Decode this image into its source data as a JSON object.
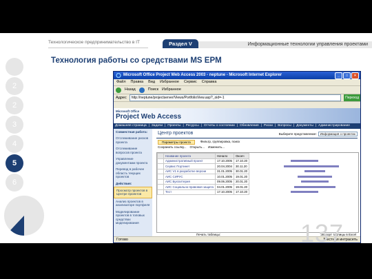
{
  "header": {
    "course_title": "Технологическое предпринимательство в IT",
    "section_label": "Раздел V",
    "section_title": "Информационные технологии управления проектами"
  },
  "slide_numbers": [
    {
      "label": "",
      "active": false
    },
    {
      "label": "2",
      "active": false
    },
    {
      "label": "2",
      "active": false
    },
    {
      "label": "3",
      "active": false
    },
    {
      "label": "4",
      "active": false
    },
    {
      "label": "5",
      "active": true
    },
    {
      "label": "6",
      "active": false
    }
  ],
  "progress": {
    "fraction": 0.12,
    "accent": "#1d3f73"
  },
  "slide": {
    "title": "Технология работы со средствами MS EPM",
    "page_number": "137"
  },
  "browser": {
    "window_title": "Microsoft Office Project Web Access 2003 - neptune - Microsoft Internet Explorer",
    "menu": [
      "Файл",
      "Правка",
      "Вид",
      "Избранное",
      "Сервис",
      "Справка"
    ],
    "toolbar": [
      "Назад",
      "Поиск",
      "Избранное"
    ],
    "address_label": "Адрес",
    "address_value": "http://neptune/projectserver/Views/PortfolioView.asp?_oid=-1",
    "go_label": "Переход",
    "status_left": "Готово",
    "status_right": "Местная интрасеть"
  },
  "pwa": {
    "logo_small": "Microsoft Office",
    "logo_big": "Project Web Access",
    "topnav": [
      "Домашняя страница",
      "Задачи",
      "Проекты",
      "Ресурсы",
      "Отчеты о состоянии",
      "Обновления",
      "Риски",
      "Вопросы",
      "Документы",
      "Администрирование"
    ],
    "leftnav": [
      {
        "label": "Совместная работа:",
        "type": "hdr"
      },
      {
        "label": "Отслеживание рисков проекта",
        "type": "item"
      },
      {
        "label": "Отслеживание вопросов проекта",
        "type": "item"
      },
      {
        "label": "Управление документами проекта",
        "type": "item"
      },
      {
        "label": "Перевод в рабочее область текущих проектов",
        "type": "item"
      },
      {
        "label": "Действия:",
        "type": "hdr"
      },
      {
        "label": "Просмотр проектов в Центре проектов",
        "type": "sel"
      },
      {
        "label": "Анализ проектов в анализаторе портфеля",
        "type": "item"
      },
      {
        "label": "Моделирование проектов в топовых средствах моделирования",
        "type": "item"
      }
    ],
    "content_title": "Центр проектов",
    "view_label": "Выберите представление:",
    "view_value": "Информация о проектах",
    "tabs": [
      "Параметры проекта",
      "Фильтр, группировка, поиск"
    ],
    "tools": [
      "Сохранить ссылку...",
      "Открыть...",
      "Изменить..."
    ],
    "columns": [
      "",
      "Название проекта",
      "Начало",
      "Оконч"
    ],
    "rows": [
      {
        "name": "Административный проект",
        "start": "17.10.2005",
        "end": "17.10.20"
      },
      {
        "name": "Сервис Портинет",
        "start": "20.04.2004",
        "end": "30.11.20"
      },
      {
        "name": "АИС V1 в разработке версии",
        "start": "31.01.2005",
        "end": "30.01.20"
      },
      {
        "name": "АИС СИРУС",
        "start": "10.01.2005",
        "end": "19.01.20"
      },
      {
        "name": "АИС Бухгалтерия",
        "start": "09.06.2005",
        "end": "20.01.20"
      },
      {
        "name": "АИС Социально-правовая защита",
        "start": "04.01.2005",
        "end": "19.01.20"
      },
      {
        "name": "Тест",
        "start": "17.10.2005",
        "end": "17.10.20"
      }
    ],
    "footer_left": "Печать таблицы:",
    "footer_right": "Экспорт таблицы в Excel"
  }
}
